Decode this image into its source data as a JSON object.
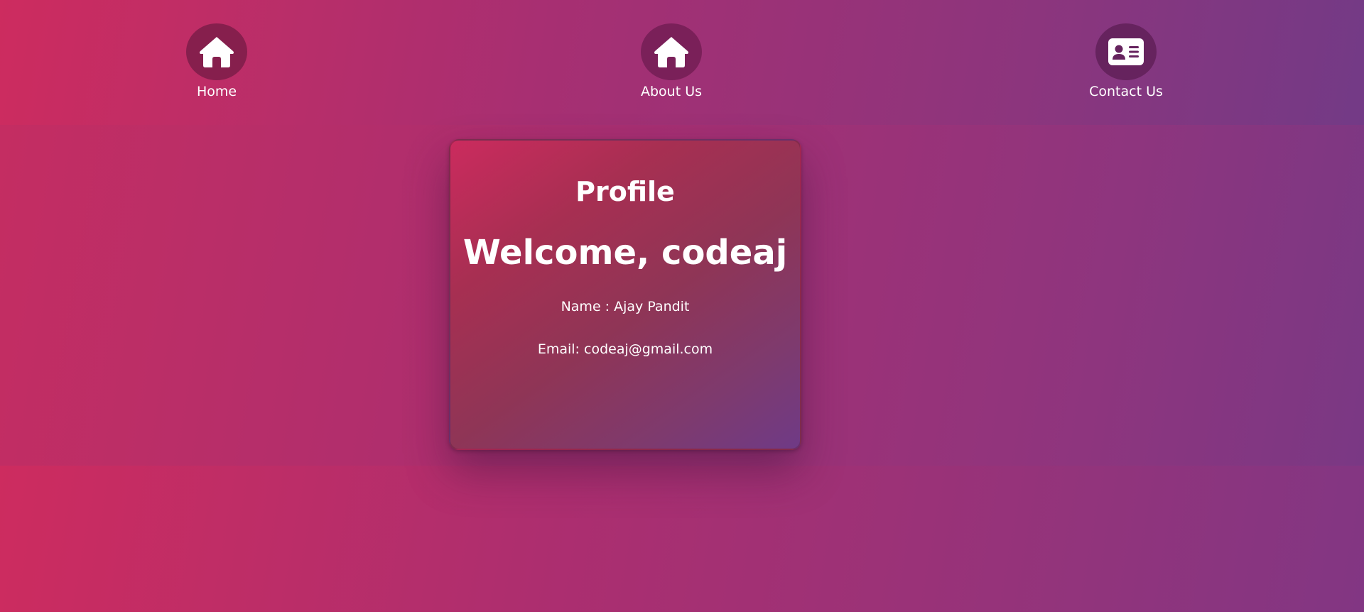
{
  "nav": {
    "items": [
      {
        "label": "Home",
        "icon": "home-icon",
        "circle_color": "#861f4d"
      },
      {
        "label": "About Us",
        "icon": "home-icon",
        "circle_color": "#7a2059"
      },
      {
        "label": "Contact Us",
        "icon": "contact-card-icon",
        "circle_color": "#66235e"
      }
    ]
  },
  "profile": {
    "title": "Profile",
    "welcome": "Welcome, codeaj",
    "name_line": "Name : Ajay Pandit",
    "email_line": "Email: codeaj@gmail.com"
  },
  "colors": {
    "gradient_start": "#cd2c5f",
    "gradient_end": "#733a86",
    "text": "#ffffff"
  }
}
